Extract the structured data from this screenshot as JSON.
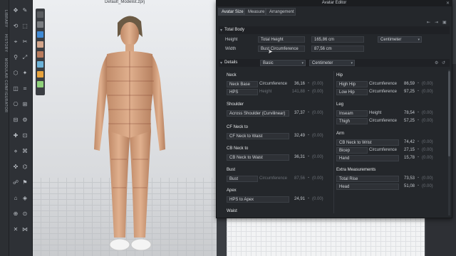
{
  "app": {
    "file_title": "Default_Modelist.zprj"
  },
  "left_tabs": [
    "LIBRARY",
    "HISTORY",
    "MODULAR CONFIGURATOR"
  ],
  "palette_colors": [
    "#5a5d61",
    "#7b7e82",
    "#3f8ad6",
    "#d3a58a",
    "#b97b5c",
    "#6bb2d9",
    "#e8a33d",
    "#8fd17a"
  ],
  "editor": {
    "title": "Avatar Editor",
    "tabs": [
      "Avatar Size",
      "Measure",
      "Arrangement"
    ],
    "total_body": {
      "header": "Total Body",
      "unit": "Centimeter",
      "rows": [
        {
          "label": "Height",
          "field": "Total Height",
          "value": "165,86 cm"
        },
        {
          "label": "Width",
          "field": "Bust Circumference",
          "value": "87,56 cm"
        }
      ]
    },
    "details": {
      "header": "Details",
      "preset": "Basic",
      "unit": "Centimeter",
      "left": {
        "neck": {
          "title": "Neck",
          "rows": [
            {
              "name": "Neck Base",
              "sub": "Circumference",
              "value": "36,16",
              "alt": "(0.00)"
            },
            {
              "name": "HPS",
              "sub": "Height",
              "value": "141,88",
              "alt": "(0.00)",
              "dim": true
            }
          ]
        },
        "shoulder": {
          "title": "Shoulder",
          "rows": [
            {
              "name": "Across Shoulder (Curvilinear)",
              "value": "37,37",
              "alt": "(0.00)"
            }
          ]
        },
        "cf": {
          "title": "CF Neck to",
          "rows": [
            {
              "name": "CF Neck to Waist",
              "value": "32,49",
              "alt": "(0.00)"
            }
          ]
        },
        "cb": {
          "title": "CB Neck to",
          "rows": [
            {
              "name": "CB Neck to Waist",
              "value": "36,31",
              "alt": "(0.00)"
            }
          ]
        },
        "bust": {
          "title": "Bust",
          "rows": [
            {
              "name": "Bust",
              "sub": "Circumference",
              "value": "87,56",
              "alt": "(0.00)",
              "dim": true
            }
          ]
        },
        "apex": {
          "title": "Apex",
          "rows": [
            {
              "name": "HPS to Apex",
              "value": "24,91",
              "alt": "(0.00)"
            }
          ]
        },
        "waist": {
          "title": "Waist"
        }
      },
      "right": {
        "hip": {
          "title": "Hip",
          "rows": [
            {
              "name": "High Hip",
              "sub": "Circumference",
              "value": "86,59",
              "alt": "(0.00)"
            },
            {
              "name": "Low Hip",
              "sub": "Circumference",
              "value": "97,25",
              "alt": "(0.00)"
            }
          ]
        },
        "leg": {
          "title": "Leg",
          "rows": [
            {
              "name": "Inseam",
              "sub": "Height",
              "value": "78,54",
              "alt": "(0.00)"
            },
            {
              "name": "Thigh",
              "sub": "Circumference",
              "value": "57,25",
              "alt": "(0.00)"
            }
          ]
        },
        "arm": {
          "title": "Arm",
          "rows": [
            {
              "name": "CB Neck to Wrist",
              "value": "74,42",
              "alt": "(0.00)"
            },
            {
              "name": "Bicep",
              "sub": "Circumference",
              "value": "27,15",
              "alt": "(0.00)"
            },
            {
              "name": "Hand",
              "value": "15,78",
              "alt": "(0.00)"
            }
          ]
        },
        "extra": {
          "title": "Extra Measurements",
          "rows": [
            {
              "name": "Total Rise",
              "value": "73,53",
              "alt": "(0.00)"
            },
            {
              "name": "Head",
              "value": "51,08",
              "alt": "(0.00)"
            }
          ]
        }
      }
    }
  }
}
